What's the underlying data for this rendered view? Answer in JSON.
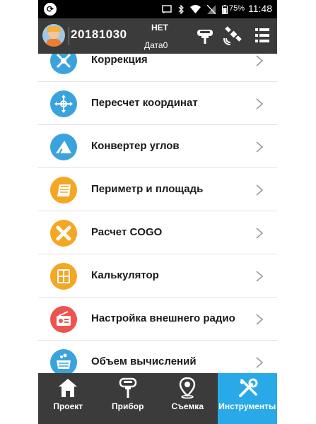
{
  "status_bar": {
    "battery": "75%",
    "time": "11:48"
  },
  "header": {
    "project_id": "20181030",
    "fix_status": "НЕТ",
    "datum": "Дата0"
  },
  "tools": [
    {
      "label": "Коррекция",
      "color": "#3aa3dd",
      "icon": "correction-icon"
    },
    {
      "label": "Пересчет координат",
      "color": "#3aa3dd",
      "icon": "coordinate-transform-icon"
    },
    {
      "label": "Конвертер углов",
      "color": "#3aa3dd",
      "icon": "angle-converter-icon"
    },
    {
      "label": "Периметр и площадь",
      "color": "#f5a623",
      "icon": "perimeter-area-icon"
    },
    {
      "label": "Расчет COGO",
      "color": "#f5a623",
      "icon": "cogo-icon"
    },
    {
      "label": "Калькулятор",
      "color": "#f5a623",
      "icon": "calculator-icon"
    },
    {
      "label": "Настройка внешнего радио",
      "color": "#ef5350",
      "icon": "radio-icon"
    },
    {
      "label": "Объем вычислений",
      "color": "#3aa3dd",
      "icon": "volume-icon"
    }
  ],
  "nav": {
    "tabs": [
      {
        "label": "Проект",
        "icon": "home-icon"
      },
      {
        "label": "Прибор",
        "icon": "receiver-icon"
      },
      {
        "label": "Съемка",
        "icon": "location-pin-icon"
      },
      {
        "label": "Инструменты",
        "icon": "tools-icon"
      }
    ],
    "active_index": 3
  }
}
